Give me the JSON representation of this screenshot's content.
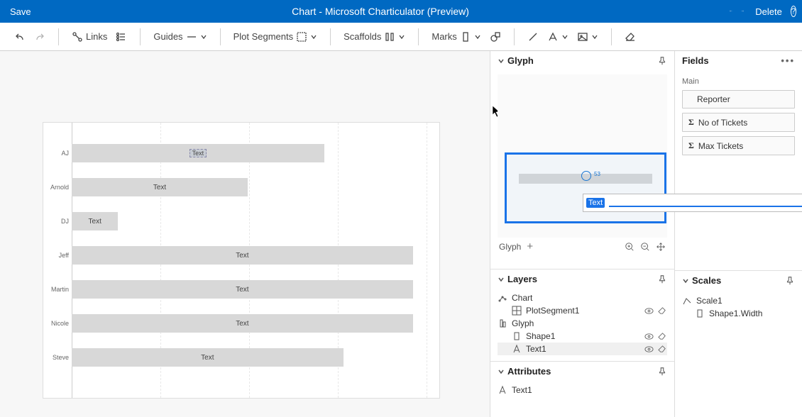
{
  "app": {
    "title": "Chart - Microsoft Charticulator (Preview)",
    "save_label": "Save",
    "delete_label": "Delete"
  },
  "toolbar": {
    "links": "Links",
    "guides": "Guides",
    "plot_segments": "Plot Segments",
    "scaffolds": "Scaffolds",
    "marks": "Marks"
  },
  "panels": {
    "glyph": {
      "title": "Glyph",
      "tab_label": "Glyph",
      "text_edit_value": "Text",
      "annot": "53"
    },
    "layers": {
      "title": "Layers",
      "chart_group": "Chart",
      "plot_segment": "PlotSegment1",
      "glyph_group": "Glyph",
      "shape": "Shape1",
      "text": "Text1"
    },
    "attributes": {
      "title": "Attributes",
      "item": "Text1"
    },
    "fields": {
      "title": "Fields",
      "subhead": "Main",
      "items": [
        "Reporter",
        "No of Tickets",
        "Max Tickets"
      ]
    },
    "scales": {
      "title": "Scales",
      "scale": "Scale1",
      "sub": "Shape1.Width"
    }
  },
  "chart_data": {
    "type": "bar",
    "orientation": "horizontal",
    "categories": [
      "AJ",
      "Arnold",
      "DJ",
      "Jeff",
      "Martin",
      "Nicole",
      "Steve"
    ],
    "values": [
      370,
      258,
      68,
      500,
      500,
      500,
      398
    ],
    "bar_label_placeholder": "Text",
    "xlabel": "",
    "ylabel": "",
    "xlim": [
      0,
      520
    ]
  },
  "colors": {
    "brand": "#0069c2",
    "accent": "#1a73e8",
    "bar": "#d8d8d8"
  }
}
